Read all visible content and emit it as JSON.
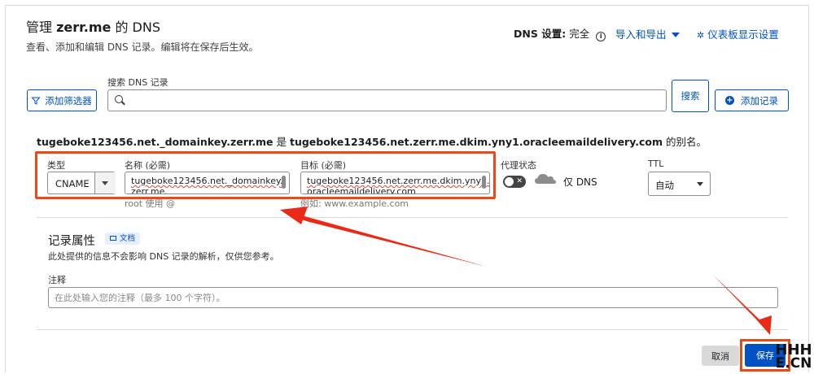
{
  "header": {
    "title_prefix": "管理 ",
    "title_domain": "zerr.me",
    "title_suffix": " 的 DNS",
    "subtitle": "查看、添加和编辑 DNS 记录。编辑将在保存后生效。",
    "dns_setting_label": "DNS 设置:",
    "dns_setting_value": "完全",
    "import_export": "导入和导出",
    "dashboard_settings": "仪表板显示设置"
  },
  "toolbar": {
    "filter_label": "添加筛选器",
    "search_label": "搜索 DNS 记录",
    "search_value": "",
    "search_button": "搜索",
    "add_record": "添加记录"
  },
  "alias_sentence": {
    "source": "tugeboke123456.net._domainkey.zerr.me",
    "connector": " 是 ",
    "target": "tugeboke123456.net.zerr.me.dkim.yny1.oracleemaildelivery.com",
    "suffix": " 的别名。"
  },
  "record": {
    "type_label": "类型",
    "type_value": "CNAME",
    "name_label": "名称 (必需)",
    "name_line1": "tugeboke123456.net._domainkey.",
    "name_line2": "zerr.me.",
    "name_hint": "root 使用 @",
    "target_label": "目标 (必需)",
    "target_line1": "tugeboke123456.net.zerr.me.dkim.yny1.",
    "target_line2": "oracleemaildelivery.com",
    "target_hint": "例如: www.example.com",
    "proxy_label": "代理状态",
    "proxy_value": "仅 DNS",
    "proxy_enabled": false,
    "ttl_label": "TTL",
    "ttl_value": "自动"
  },
  "attributes": {
    "title": "记录属性",
    "doc_badge": "文档",
    "description": "此处提供的信息不会影响 DNS 记录的解析，仅供您参考。",
    "note_label": "注释",
    "note_placeholder": "在此处输入您的注释（最多 100 个字符）。",
    "note_value": ""
  },
  "footer": {
    "cancel": "取消",
    "save": "保存"
  },
  "watermark": {
    "line1": "HHH",
    "line2": "E.CN"
  },
  "colors": {
    "accent": "#0051c3",
    "annotation": "#ea4a19",
    "border": "#8e8e8e"
  },
  "icons": [
    "info-icon",
    "chevron-down-icon",
    "gear-icon",
    "filter-icon",
    "search-icon",
    "plus-circle-icon",
    "close-icon",
    "cloud-icon",
    "book-icon"
  ]
}
